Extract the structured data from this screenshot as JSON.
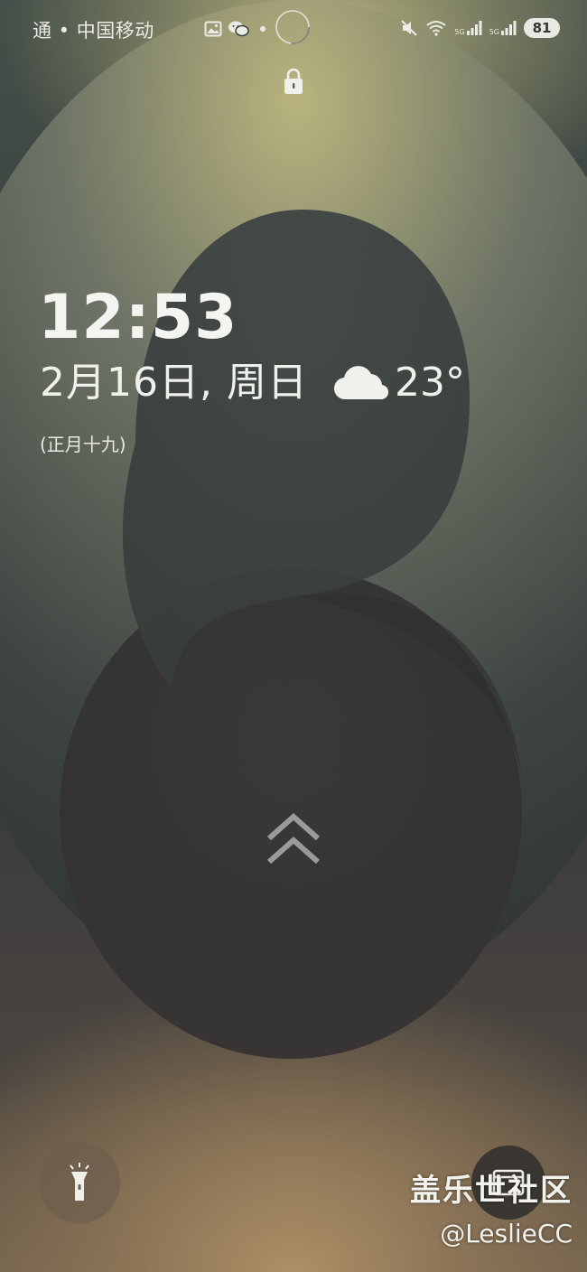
{
  "status_bar": {
    "carrier": "通 • 中国移动",
    "left_icons": [
      "gallery-icon",
      "wechat-icon"
    ],
    "right_icons": [
      "mute-icon",
      "wifi-icon",
      "signal-5g-icon",
      "signal-5g-icon"
    ],
    "signal_label_1": "5G",
    "signal_label_2": "5G",
    "battery_level": "81"
  },
  "lock_screen": {
    "time": "12:53",
    "date": "2月16日, 周日",
    "weather": {
      "icon": "cloud-icon",
      "temperature": "23°"
    },
    "lunar_date": "(正月十九)"
  },
  "shortcuts": {
    "left": "flashlight-icon",
    "right": "camera-icon"
  },
  "watermark": {
    "site": "盖乐世社区",
    "user": "@LeslieCC"
  },
  "colors": {
    "text": "#f4f4f0",
    "wallpaper_top": "#c3bd86",
    "wallpaper_bottom": "#a58a62",
    "wallpaper_dark": "#343436"
  }
}
